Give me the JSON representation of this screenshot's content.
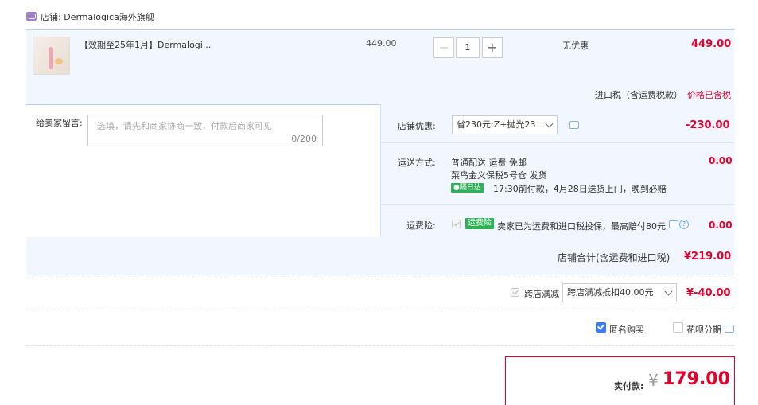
{
  "store": {
    "name": "店铺: Dermalogica海外旗舰"
  },
  "item": {
    "title": "【效期至25年1月】Dermalogi...",
    "price": "449.00",
    "quantity": "1",
    "discount": "无优惠",
    "subtotal": "449.00",
    "tax_label": "进口税（含运费税款）",
    "tax_status": "价格已含税"
  },
  "message": {
    "label": "给卖家留言:",
    "placeholder": "选填，请先和商家协商一致，付款后商家可见",
    "counter": "0/200"
  },
  "shop_discount": {
    "label": "店铺优惠:",
    "selected": "省230元:Z+抛光23",
    "amount": "-230.00"
  },
  "shipping": {
    "label": "运送方式:",
    "line1": "普通配送 运费 免邮",
    "line2": "菜鸟金义保税5号仓  发货",
    "badge": "隔日达",
    "line3": "17:30前付款，4月28日送货上门，晚到必赔",
    "amount": "0.00"
  },
  "insurance": {
    "label": "运费险:",
    "badge": "运费险",
    "desc": "卖家已为运费和进口税投保，最高赔付80元",
    "amount": "0.00"
  },
  "store_total": {
    "label": "店铺合计(含运费和进口税)",
    "amount": "¥219.00"
  },
  "cross_store": {
    "label": "跨店满减",
    "selected": "跨店满减抵扣40.00元",
    "amount": "¥-40.00"
  },
  "options": {
    "anonymous": "匿名购买",
    "installment": "花呗分期"
  },
  "payment": {
    "label": "实付款:",
    "currency": "¥",
    "amount": "179.00"
  },
  "colors": {
    "accent_red": "#e4002b",
    "link_blue": "#3b7cff",
    "panel_blue": "#f2f7ff"
  }
}
